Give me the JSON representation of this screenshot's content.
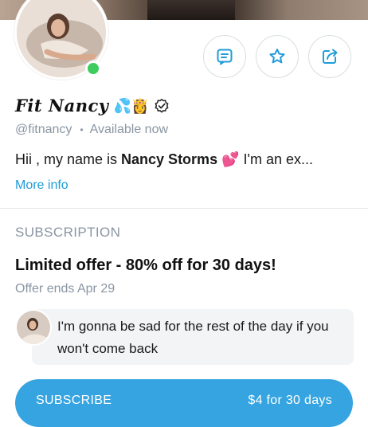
{
  "profile": {
    "name": "Fit Nancy",
    "name_emojis": "💦👸",
    "handle": "@fitnancy",
    "status": "Available now",
    "bio_prefix": "Hii , my name is ",
    "bio_bold": "Nancy Storms",
    "bio_emoji": "💕",
    "bio_suffix": " I'm an ex...",
    "more_info": "More info",
    "online": true
  },
  "actions": [
    {
      "icon": "message-icon"
    },
    {
      "icon": "star-icon"
    },
    {
      "icon": "share-icon"
    }
  ],
  "subscription": {
    "section_title": "SUBSCRIPTION",
    "offer_title": "Limited offer - 80% off for 30 days!",
    "offer_ends": "Offer ends Apr 29",
    "message": "I'm gonna be sad for the rest of the day if you won't come back",
    "button_label": "SUBSCRIBE",
    "button_price": "$4 for 30 days"
  },
  "colors": {
    "accent": "#1f9cd9",
    "button": "#35a4e0",
    "muted": "#8a96a3",
    "online": "#3dcc5d"
  }
}
